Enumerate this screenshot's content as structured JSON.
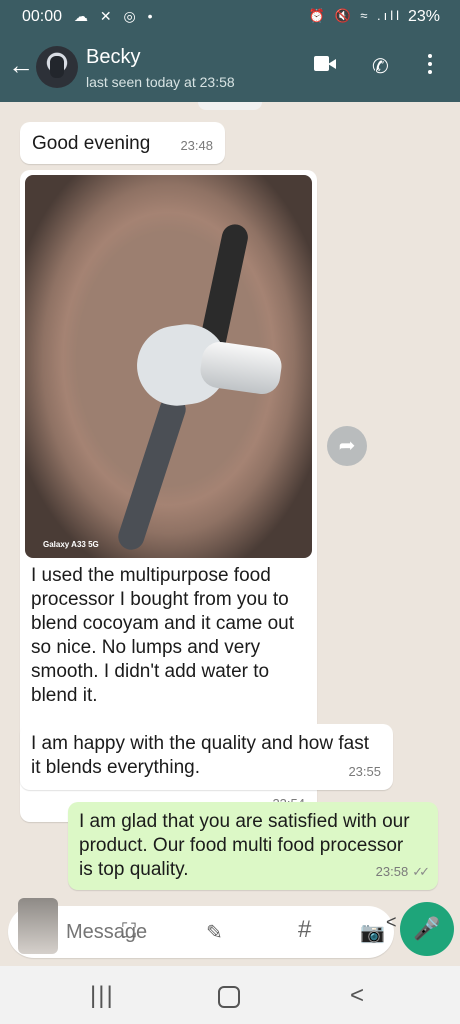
{
  "status_bar": {
    "time": "00:00",
    "left_icons": "☁ ✕ ◎ •",
    "right_icons": "⏰ 🔇 ≈ .ıll",
    "battery": "23%"
  },
  "header": {
    "back_glyph": "←",
    "contact_name": "Becky",
    "last_seen": "last seen today at 23:58",
    "call_glyph": "✆"
  },
  "messages": [
    {
      "text": "Good evening",
      "time": "23:48"
    },
    {
      "image_watermark": "Galaxy A33 5G",
      "text": "I used the multipurpose food processor I bought from you to blend cocoyam and it came out so nice. No lumps and very smooth. I didn't add water to blend it.",
      "time": "23:54"
    },
    {
      "text": "I am happy with the quality and how fast it blends everything.",
      "time": "23:55"
    },
    {
      "text": "I am glad that you are satisfied with our product. Our food multi food processor is top quality.",
      "time": "23:58",
      "ticks": "✓✓"
    }
  ],
  "forward_glyph": "➦",
  "composer": {
    "placeholder": "Message",
    "scan_glyph": "⛶",
    "sticker_glyph": "✎",
    "hash_glyph": "#",
    "camera_glyph": "📷",
    "share_glyph": "<",
    "mic_glyph": "🎤"
  },
  "nav": {
    "recents_glyph": "|||",
    "back_glyph": "<"
  }
}
